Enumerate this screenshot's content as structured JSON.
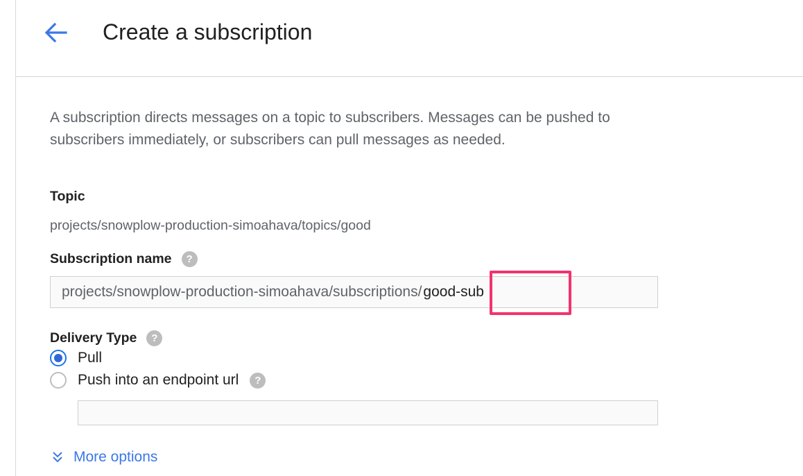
{
  "header": {
    "title": "Create a subscription"
  },
  "description": "A subscription directs messages on a topic to subscribers. Messages can be pushed to subscribers immediately, or subscribers can pull messages as needed.",
  "topic": {
    "label": "Topic",
    "value": "projects/snowplow-production-simoahava/topics/good"
  },
  "subscription_name": {
    "label": "Subscription name",
    "prefix": "projects/snowplow-production-simoahava/subscriptions/",
    "value": "good-sub"
  },
  "delivery_type": {
    "label": "Delivery Type",
    "options": [
      {
        "label": "Pull",
        "selected": true
      },
      {
        "label": "Push into an endpoint url",
        "selected": false
      }
    ],
    "endpoint_value": ""
  },
  "more_options": {
    "label": "More options"
  },
  "colors": {
    "accent": "#3b78e7",
    "highlight": "#f2336d",
    "help_icon": "#bdbdbd"
  },
  "icons": {
    "back": "arrow-left-icon",
    "help": "help-circle-icon",
    "expand": "double-chevron-down-icon"
  }
}
